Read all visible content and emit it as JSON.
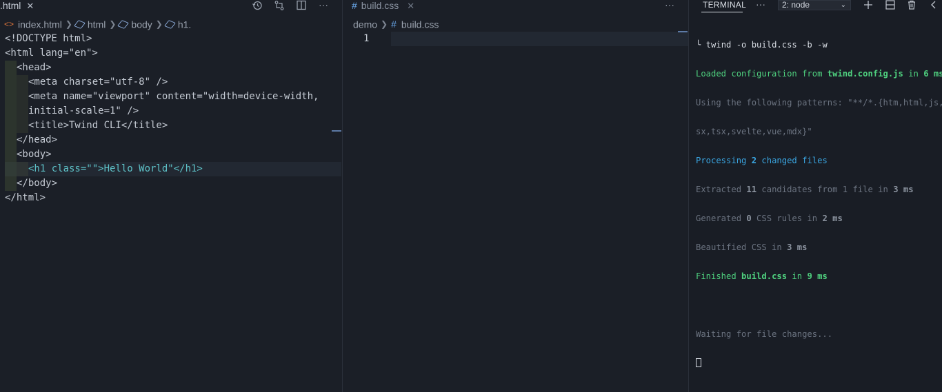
{
  "left_editor": {
    "tab_label": ".html",
    "breadcrumb": [
      "index.html",
      "html",
      "body",
      "h1."
    ],
    "lines": [
      "<!DOCTYPE html>",
      "<html lang=\"en\">",
      "<head>",
      "<meta charset=\"utf-8\" />",
      "<meta name=\"viewport\" content=\"width=device-width,",
      "initial-scale=1\" />",
      "<title>Twind CLI</title>",
      "</head>",
      "<body>",
      "<h1 class=\"\">Hello World\"</h1>",
      "</body>",
      "</html>"
    ]
  },
  "middle_editor": {
    "tab_label": "build.css",
    "breadcrumb": [
      "demo",
      "build.css"
    ],
    "line_number": "1"
  },
  "terminal": {
    "title": "TERMINAL",
    "dropdown": "2: node",
    "command": "twind -o build.css -b -w",
    "loaded_prefix": "Loaded configuration from ",
    "config_file": "twind.config.js",
    "loaded_in": " in ",
    "loaded_time": "6 ms",
    "patterns_1": "Using the following patterns: \"**/*.{htm,html,js,j",
    "patterns_2": "sx,tsx,svelte,vue,mdx}\"",
    "processing": "Processing ",
    "processing_count": "2",
    "processing_suffix": " changed files",
    "extracted": "Extracted ",
    "extracted_count": "11",
    "extracted_suffix": " candidates from 1 file in ",
    "extracted_time": "3 ms",
    "generated": "Generated ",
    "generated_count": "0",
    "generated_suffix": " CSS rules in ",
    "generated_time": "2 ms",
    "beautified": "Beautified CSS in ",
    "beautified_time": "3 ms",
    "finished": "Finished ",
    "finished_file": "build.css",
    "finished_in": " in ",
    "finished_time": "9 ms",
    "waiting": "Waiting for file changes..."
  },
  "colors": {
    "background": "#1b1f27",
    "tag": "#5ec2c8",
    "attribute": "#b294d9",
    "terminal_green": "#4fd17f",
    "terminal_cyan": "#3aa6e2"
  },
  "icons": [
    "history-icon",
    "git-compare-icon",
    "split-editor-icon",
    "more-icon",
    "close-icon",
    "add-terminal-icon",
    "split-terminal-icon",
    "trash-icon",
    "collapse-icon"
  ]
}
